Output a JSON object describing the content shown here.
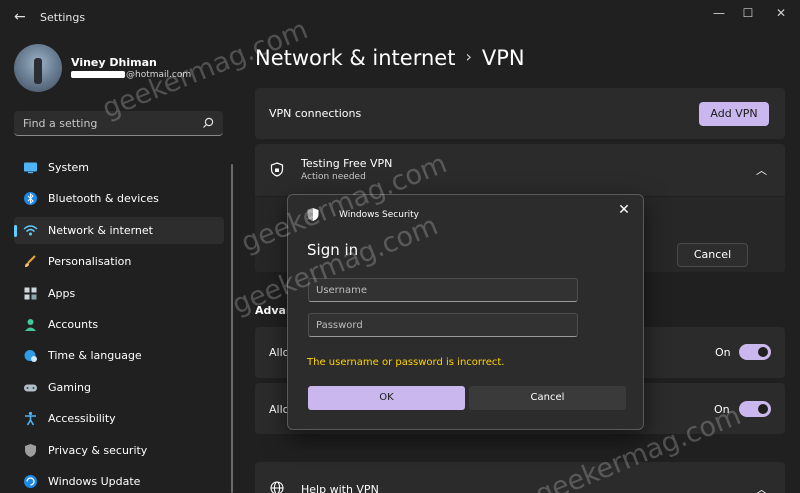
{
  "window": {
    "title": "Settings",
    "controls": {
      "minimize": "—",
      "maximize": "☐",
      "close": "✕"
    }
  },
  "user": {
    "name": "Viney Dhiman",
    "email_suffix": "@hotmail.com"
  },
  "search": {
    "placeholder": "Find a setting"
  },
  "sidebar": {
    "items": [
      {
        "label": "System",
        "icon": "monitor-icon",
        "active": false
      },
      {
        "label": "Bluetooth & devices",
        "icon": "bluetooth-icon",
        "active": false
      },
      {
        "label": "Network & internet",
        "icon": "wifi-icon",
        "active": true
      },
      {
        "label": "Personalisation",
        "icon": "brush-icon",
        "active": false
      },
      {
        "label": "Apps",
        "icon": "apps-icon",
        "active": false
      },
      {
        "label": "Accounts",
        "icon": "person-icon",
        "active": false
      },
      {
        "label": "Time & language",
        "icon": "globe-clock-icon",
        "active": false
      },
      {
        "label": "Gaming",
        "icon": "gamepad-icon",
        "active": false
      },
      {
        "label": "Accessibility",
        "icon": "accessibility-icon",
        "active": false
      },
      {
        "label": "Privacy & security",
        "icon": "shield-icon",
        "active": false
      },
      {
        "label": "Windows Update",
        "icon": "update-icon",
        "active": false
      }
    ]
  },
  "breadcrumb": {
    "parent": "Network & internet",
    "separator": "›",
    "current": "VPN"
  },
  "vpn": {
    "connections_label": "VPN connections",
    "add_button": "Add VPN",
    "connection_name": "Testing Free VPN",
    "connection_status": "Action needed",
    "cancel_button": "Cancel",
    "advanced_label": "Advan",
    "toggles": [
      {
        "label": "Allo",
        "state": "On"
      },
      {
        "label": "Allo",
        "state": "On"
      }
    ],
    "help_label": "Help with VPN"
  },
  "dialog": {
    "title": "Windows Security",
    "close": "✕",
    "heading": "Sign in",
    "username_placeholder": "Username",
    "password_placeholder": "Password",
    "error": "The username or password is incorrect.",
    "ok": "OK",
    "cancel": "Cancel"
  },
  "watermark": {
    "text": "geekermag.com"
  },
  "colors": {
    "background": "#202020",
    "card": "#2b2b2b",
    "accent": "#c9b7ee",
    "nav_indicator": "#60cdff",
    "error": "#ffd400"
  }
}
